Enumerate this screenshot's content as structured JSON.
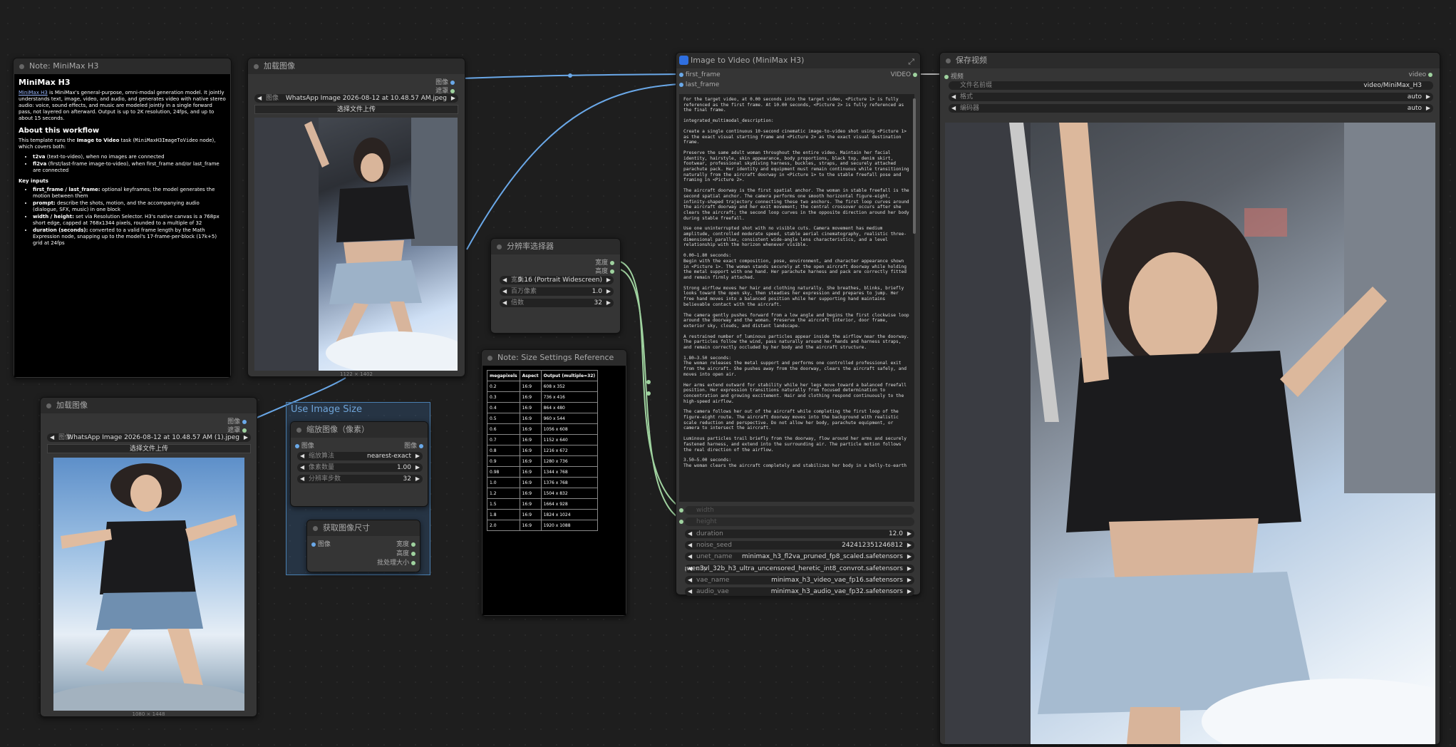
{
  "colors": {
    "link": "#6aa8e8",
    "link_green": "#9fd29f",
    "canvas": "#1e1e1e",
    "node": "#353535",
    "group": "#4a7fb0"
  },
  "note_h3": {
    "title": "Note: MiniMax H3",
    "h1": "MiniMax H3",
    "intro_link": "MiniMax H3",
    "intro": " is MiniMax's general-purpose, omni-modal generation model. It jointly understands text, image, video, and audio, and generates video with native stereo audio: voice, sound effects, and music are modeled jointly in a single forward pass, not layered on afterward. Output is up to 2K resolution, 24fps, and up to about 15 seconds.",
    "h2": "About this workflow",
    "p2a": "This template runs the ",
    "p2b": "Image to Video",
    "p2c": " task (",
    "p2d": "MiniMaxH3ImageToVideo",
    "p2e": " node), which covers both:",
    "li1b": "t2va",
    "li1": " (text-to-video), when no images are connected",
    "li2b": "fl2va",
    "li2": " (first/last-frame image-to-video), when first_frame and/or last_frame are connected",
    "h3": "Key inputs",
    "k1b": "first_frame / last_frame:",
    "k1": " optional keyframes; the model generates the motion between them",
    "k2b": "prompt:",
    "k2": " describe the shots, motion, and the accompanying audio (dialogue, SFX, music) in one block",
    "k3b": "width / height:",
    "k3": " set via Resolution Selector. H3's native canvas is a 768px short edge, capped at 768x1344 pixels, rounded to a multiple of 32",
    "k4b": "duration (seconds):",
    "k4": " converted to a valid frame length by the Math Expression node, snapping up to the model's 17-frame-per-block (17k+5) grid at 24fps"
  },
  "load1": {
    "title": "加载图像",
    "out_image": "图像",
    "out_mask": "遮罩",
    "w_label": "图像",
    "w_value": "WhatsApp Image 2026-08-12 at 10.48.57 AM.jpeg",
    "upload": "选择文件上传",
    "dim": "1122 × 1402"
  },
  "load2": {
    "title": "加载图像",
    "out_image": "图像",
    "out_mask": "遮罩",
    "w_label": "图像",
    "w_value": "WhatsApp Image 2026-08-12 at 10.48.57 AM (1).jpeg",
    "upload": "选择文件上传",
    "dim": "1080 × 1448"
  },
  "group": {
    "title": "Use Image Size",
    "scale_title": "缩放图像（像素）",
    "scale_in": "图像",
    "scale_out": "图像",
    "w1_l": "缩放算法",
    "w1_v": "nearest-exact",
    "w2_l": "像素数量",
    "w2_v": "1.00",
    "w3_l": "分辨率步数",
    "w3_v": "32",
    "size_title": "获取图像尺寸",
    "size_in": "图像",
    "size_w": "宽度",
    "size_h": "高度",
    "size_b": "批处理大小"
  },
  "res": {
    "title": "分辨率选择器",
    "out_w": "宽度",
    "out_h": "高度",
    "w1_l": "宽高...",
    "w1_v": "9:16 (Portrait Widescreen)",
    "w2_l": "百万像素",
    "w2_v": "1.0",
    "w3_l": "倍数",
    "w3_v": "32"
  },
  "size_note": {
    "title": "Note: Size Settings Reference",
    "headers": [
      "megapixels",
      "Aspect",
      "Output (multiple=32)"
    ],
    "rows": [
      [
        "0.2",
        "16:9",
        "608 x 352"
      ],
      [
        "0.3",
        "16:9",
        "736 x 416"
      ],
      [
        "0.4",
        "16:9",
        "864 x 480"
      ],
      [
        "0.5",
        "16:9",
        "960 x 544"
      ],
      [
        "0.6",
        "16:9",
        "1056 x 608"
      ],
      [
        "0.7",
        "16:9",
        "1152 x 640"
      ],
      [
        "0.8",
        "16:9",
        "1216 x 672"
      ],
      [
        "0.9",
        "16:9",
        "1280 x 736"
      ],
      [
        "0.98",
        "16:9",
        "1344 x 768"
      ],
      [
        "1.0",
        "16:9",
        "1376 x 768"
      ],
      [
        "1.2",
        "16:9",
        "1504 x 832"
      ],
      [
        "1.5",
        "16:9",
        "1664 x 928"
      ],
      [
        "1.8",
        "16:9",
        "1824 x 1024"
      ],
      [
        "2.0",
        "16:9",
        "1920 x 1088"
      ]
    ]
  },
  "i2v": {
    "title": "Image to Video (MiniMax H3)",
    "in1": "first_frame",
    "in2": "last_frame",
    "out": "VIDEO",
    "prompt": [
      "For the target video, at 0.00 seconds into the target video, <Picture 1> is fully referenced as the first frame. At 10.00 seconds, <Picture 2> is fully referenced as the final frame.",
      "integrated_multimodal_description:",
      "Create a single continuous 10-second cinematic image-to-video shot using <Picture 1> as the exact visual starting frame and <Picture 2> as the exact visual destination frame.",
      "Preserve the same adult woman throughout the entire video. Maintain her facial identity, hairstyle, skin appearance, body proportions, black top, denim skirt, footwear, professional skydiving harness, buckles, straps, and securely attached parachute pack. Her identity and equipment must remain continuous while transitioning naturally from the aircraft doorway in <Picture 1> to the stable freefall pose and framing in <Picture 2>.",
      "The aircraft doorway is the first spatial anchor. The woman in stable freefall is the second spatial anchor. The camera performs one smooth horizontal figure-eight, infinity-shaped trajectory connecting these two anchors. The first loop curves around the aircraft doorway and her exit movement; the central crossover occurs after she clears the aircraft; the second loop curves in the opposite direction around her body during stable freefall.",
      "Use one uninterrupted shot with no visible cuts. Camera movement has medium amplitude, controlled moderate speed, stable aerial cinematography, realistic three-dimensional parallax, consistent wide-angle lens characteristics, and a level relationship with the horizon whenever visible.",
      "0.00–1.80 seconds:\nBegin with the exact composition, pose, environment, and character appearance shown in <Picture 1>. The woman stands securely at the open aircraft doorway while holding the metal support with one hand. Her parachute harness and pack are correctly fitted and remain firmly attached.",
      "Strong airflow moves her hair and clothing naturally. She breathes, blinks, briefly looks toward the open sky, then steadies her expression and prepares to jump. Her free hand moves into a balanced position while her supporting hand maintains believable contact with the aircraft.",
      "The camera gently pushes forward from a low angle and begins the first clockwise loop around the doorway and the woman. Preserve the aircraft interior, door frame, exterior sky, clouds, and distant landscape.",
      "A restrained number of luminous particles appear inside the airflow near the doorway. The particles follow the wind, pass naturally around her hands and harness straps, and remain correctly occluded by her body and the aircraft structure.",
      "1.80–3.50 seconds:\nThe woman releases the metal support and performs one controlled professional exit from the aircraft. She pushes away from the doorway, clears the aircraft safely, and moves into open air.",
      "Her arms extend outward for stability while her legs move toward a balanced freefall position. Her expression transitions naturally from focused determination to concentration and growing excitement. Hair and clothing respond continuously to the high-speed airflow.",
      "The camera follows her out of the aircraft while completing the first loop of the figure-eight route. The aircraft doorway moves into the background with realistic scale reduction and perspective. Do not allow her body, parachute equipment, or camera to intersect the aircraft.",
      "Luminous particles trail briefly from the doorway, flow around her arms and securely fastened harness, and extend into the surrounding air. The particle motion follows the real direction of the airflow.",
      "3.50–5.00 seconds:\nThe woman clears the aircraft completely and stabilizes her body in a belly-to-earth"
    ],
    "w_width": "width",
    "w_height": "height",
    "widgets": [
      {
        "l": "duration",
        "v": "12.0"
      },
      {
        "l": "noise_seed",
        "v": "242412351246812"
      },
      {
        "l": "unet_name",
        "v": "minimax_h3_fl2va_pruned_fp8_scaled.safetensors"
      },
      {
        "l": "clip",
        "v": "qwen3vl_32b_h3_ultra_uncensored_heretic_int8_convrot.safetensors"
      },
      {
        "l": "vae_name",
        "v": "minimax_h3_video_vae_fp16.safetensors"
      },
      {
        "l": "audio_vae",
        "v": "minimax_h3_audio_vae_fp32.safetensors"
      }
    ]
  },
  "save": {
    "title": "保存视频",
    "in": "视频",
    "in_type": "video",
    "w1_l": "文件名前缀",
    "w1_v": "video/MiniMax_H3",
    "w2_l": "格式",
    "w2_v": "auto",
    "w3_l": "编码器",
    "w3_v": "auto"
  }
}
